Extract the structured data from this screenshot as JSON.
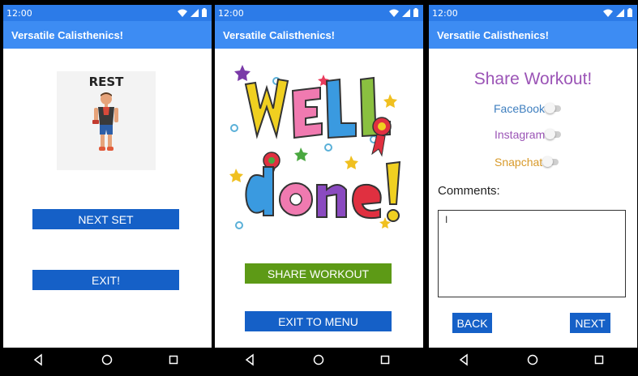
{
  "status": {
    "time": "12:00"
  },
  "app": {
    "title": "Versatile Calisthenics!"
  },
  "screen1": {
    "image_text": "REST",
    "next_set_label": "NEXT SET",
    "exit_label": "EXIT!"
  },
  "screen2": {
    "share_workout_label": "SHARE WORKOUT",
    "exit_to_menu_label": "EXIT TO MENU",
    "share_button_color": "#5d9a16"
  },
  "screen3": {
    "title": "Share Workout!",
    "facebook_label": "FaceBook",
    "instagram_label": "Instagram",
    "snapchat_label": "Snapchat",
    "facebook_color": "#3f7fbf",
    "instagram_color": "#9b54b6",
    "snapchat_color": "#d89a2a",
    "comments_label": "Comments:",
    "comments_value": "I",
    "back_label": "BACK",
    "next_label": "NEXT"
  },
  "icons": {
    "status": [
      "wifi-icon",
      "signal-icon",
      "battery-icon"
    ],
    "nav": [
      "back-triangle-icon",
      "home-circle-icon",
      "recent-square-icon"
    ]
  },
  "colors": {
    "status_bar": "#2c7be8",
    "app_bar": "#3d8cf3",
    "button": "#1560c7"
  }
}
